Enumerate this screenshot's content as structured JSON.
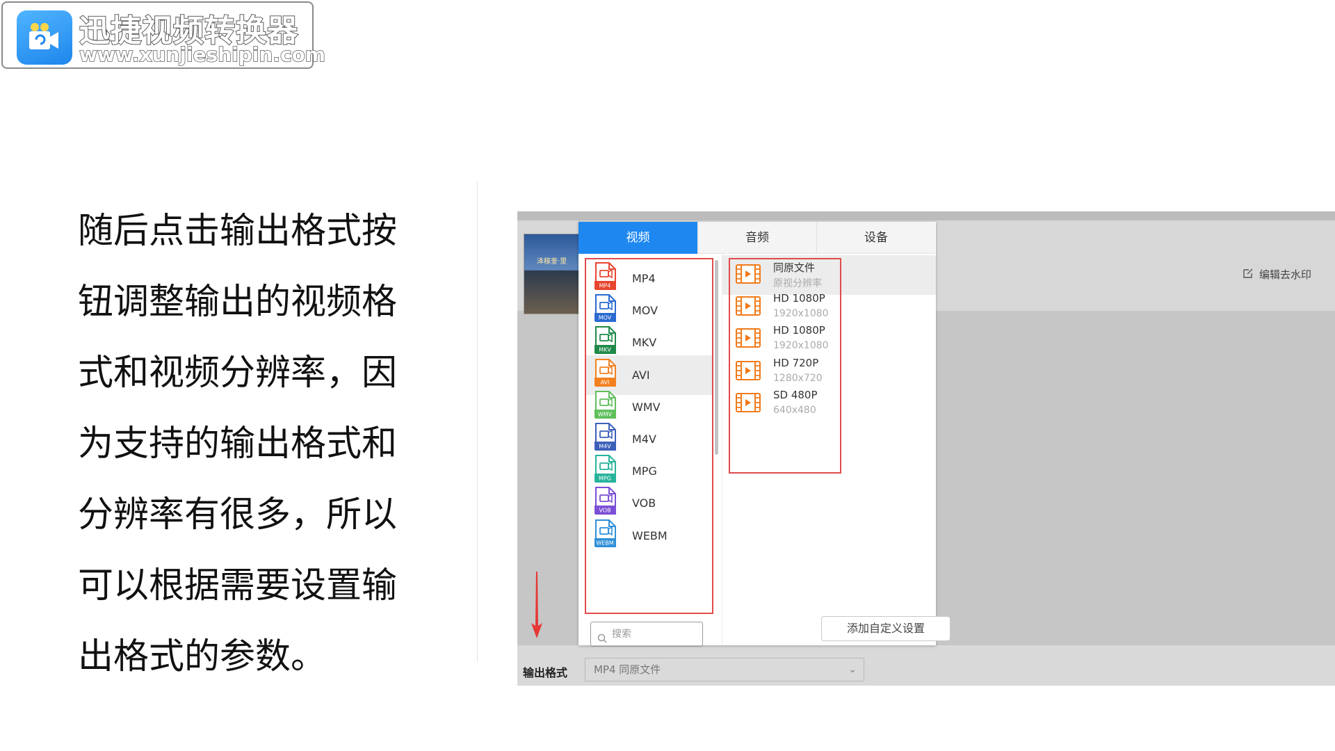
{
  "logo": {
    "title": "迅捷视频转换器",
    "url": "www.xunjieshipin.com"
  },
  "description": {
    "lines": [
      "随后点击输出格式按",
      "钮调整输出的视频格",
      "式和视频分辨率，因",
      "为支持的输出格式和",
      "分辨率有很多，所以",
      "可以根据需要设置输",
      "出格式的参数。"
    ]
  },
  "app": {
    "thumbnail_text": "泽稼奎·里",
    "watermark_label": "编辑去水印",
    "output_label": "输出格式",
    "output_value": "MP4   同原文件",
    "tabs": [
      "视频",
      "音频",
      "设备"
    ],
    "formats": [
      {
        "name": "MP4",
        "badge": "MP4",
        "color": "#e8452f"
      },
      {
        "name": "MOV",
        "badge": "MOV",
        "color": "#2a6bd1"
      },
      {
        "name": "MKV",
        "badge": "MKV",
        "color": "#1f8a4a"
      },
      {
        "name": "AVI",
        "badge": "AVI",
        "color": "#f2801f"
      },
      {
        "name": "WMV",
        "badge": "WMV",
        "color": "#5fbf5c"
      },
      {
        "name": "M4V",
        "badge": "M4V",
        "color": "#3c5fb8"
      },
      {
        "name": "MPG",
        "badge": "MPG",
        "color": "#27b39a"
      },
      {
        "name": "VOB",
        "badge": "VOB",
        "color": "#7a4fd6"
      },
      {
        "name": "WEBM",
        "badge": "WEBM",
        "color": "#2f8fd8"
      }
    ],
    "resolutions": [
      {
        "name": "同原文件",
        "sub": "原视分辨率"
      },
      {
        "name": "HD 1080P",
        "sub": "1920x1080"
      },
      {
        "name": "HD 1080P",
        "sub": "1920x1080"
      },
      {
        "name": "HD 720P",
        "sub": "1280x720"
      },
      {
        "name": "SD 480P",
        "sub": "640x480"
      }
    ],
    "search_placeholder": "搜索",
    "add_custom_label": "添加自定义设置",
    "colors": {
      "accent": "#1e88f0",
      "highlight_border": "#e04a4a",
      "arrow": "#e53935"
    }
  }
}
